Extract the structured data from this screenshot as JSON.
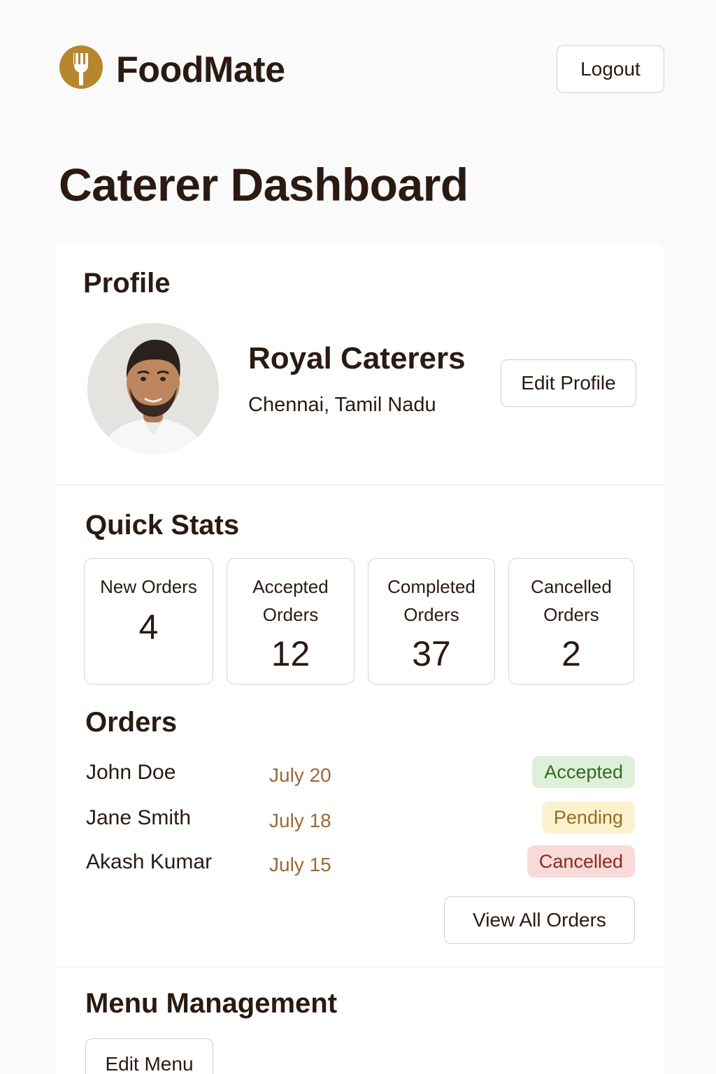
{
  "app": {
    "name": "FoodMate",
    "logout_label": "Logout",
    "colors": {
      "brand_gold": "#b8862e",
      "text_dark": "#2a1a12",
      "date_brown": "#9a6a3a"
    }
  },
  "page_title": "Caterer Dashboard",
  "profile": {
    "section_title": "Profile",
    "business_name": "Royal Caterers",
    "location": "Chennai, Tamil Nadu",
    "edit_label": "Edit Profile"
  },
  "stats": {
    "section_title": "Quick Stats",
    "items": [
      {
        "label": "New Orders",
        "value": "4"
      },
      {
        "label": "Accepted Orders",
        "value": "12"
      },
      {
        "label": "Completed Orders",
        "value": "37"
      },
      {
        "label": "Cancelled Orders",
        "value": "2"
      }
    ]
  },
  "orders": {
    "section_title": "Orders",
    "rows": [
      {
        "name": "John Doe",
        "date": "July 20",
        "status": "Accepted",
        "status_bg": "#dff0da",
        "status_fg": "#2f6b1f"
      },
      {
        "name": "Jane Smith",
        "date": "July 18",
        "status": "Pending",
        "status_bg": "#fbf2cf",
        "status_fg": "#9a6a20"
      },
      {
        "name": "Akash Kumar",
        "date": "July 15",
        "status": "Cancelled",
        "status_bg": "#f8dad8",
        "status_fg": "#8a2a22"
      }
    ],
    "view_all_label": "View All Orders"
  },
  "menu": {
    "section_title": "Menu Management",
    "edit_label": "Edit Menu"
  }
}
